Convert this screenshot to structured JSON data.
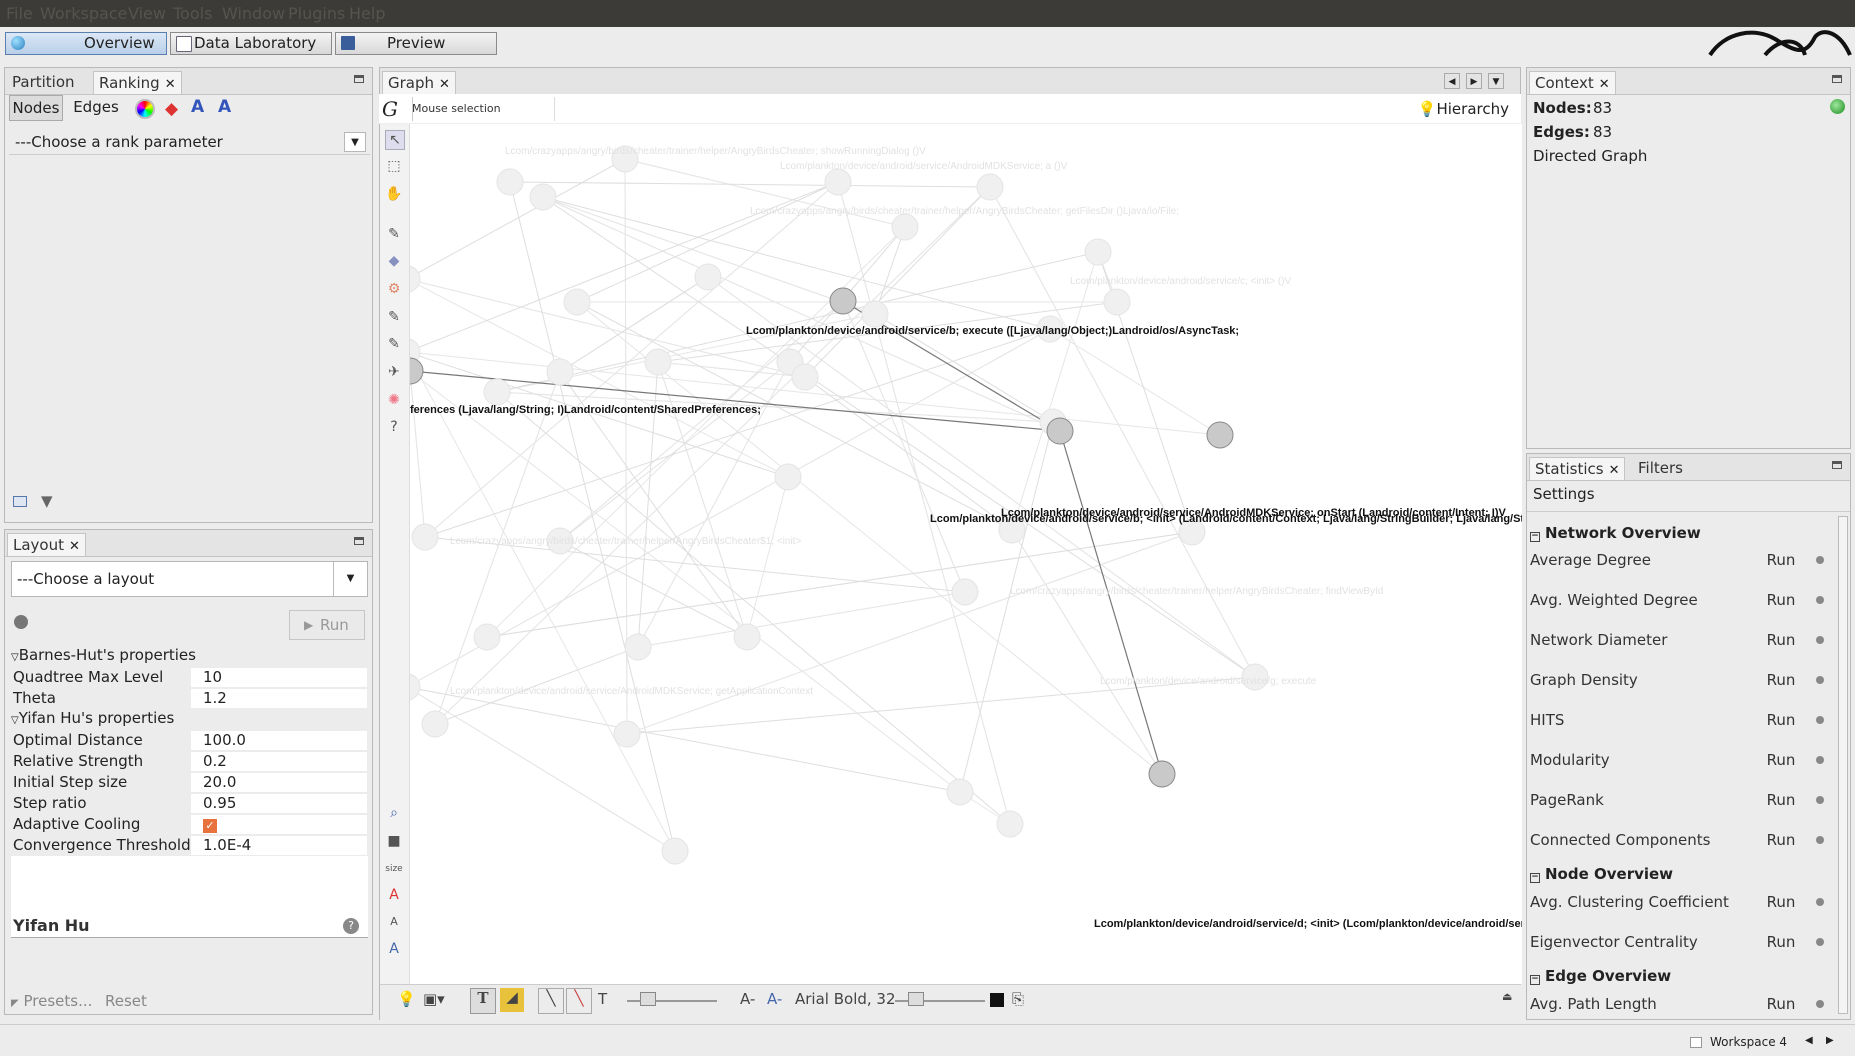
{
  "menu": [
    "File",
    "Workspace",
    "View",
    "Tools",
    "Window",
    "Plugins",
    "Help"
  ],
  "top_tabs": [
    "Overview",
    "Data Laboratory",
    "Preview"
  ],
  "left_panel": {
    "tabs": [
      "Partition",
      "Ranking"
    ],
    "subtabs": [
      "Nodes",
      "Edges"
    ],
    "rank_param": "---Choose a rank parameter"
  },
  "layout_panel": {
    "title": "Layout",
    "choose": "---Choose a layout",
    "run": "Run",
    "bh_section": "Barnes-Hut's properties",
    "yh_section": "Yifan Hu's properties",
    "props": [
      {
        "k": "Quadtree Max Level",
        "v": "10"
      },
      {
        "k": "Theta",
        "v": "1.2"
      },
      {
        "k": "Optimal Distance",
        "v": "100.0"
      },
      {
        "k": "Relative Strength",
        "v": "0.2"
      },
      {
        "k": "Initial Step size",
        "v": "20.0"
      },
      {
        "k": "Step ratio",
        "v": "0.95"
      },
      {
        "k": "Adaptive Cooling",
        "v": ""
      },
      {
        "k": "Convergence Threshold",
        "v": "1.0E-4"
      }
    ],
    "algo_name": "Yifan Hu",
    "presets": "Presets...",
    "reset": "Reset"
  },
  "graph": {
    "tab": "Graph",
    "mode": "Mouse selection",
    "hierarchy": "Hierarchy",
    "font_label": "Arial Bold, 32",
    "node_labels": [
      "Lcom/plankton/device/android/service/b; execute ([Ljava/lang/Object;)Landroid/os/AsyncTask;",
      "ferences (Ljava/lang/String; I)Landroid/content/SharedPreferences;",
      "Lcom/plankton/device/android/service/AndroidMDKService; onStart (Landroid/content/Intent; I)V",
      "Lcom/plankton/device/android/service/b; <init> (Landroid/content/Context; Ljava/lang/StringBuilder; Ljava/lang/Str",
      "Lcom/plankton/device/android/service/d; <init> (Lcom/plankton/device/android/serv"
    ]
  },
  "context": {
    "title": "Context",
    "nodes_label": "Nodes:",
    "nodes": "83",
    "edges_label": "Edges:",
    "edges": "83",
    "type": "Directed Graph"
  },
  "statistics": {
    "tabs": [
      "Statistics",
      "Filters"
    ],
    "settings": "Settings",
    "run": "Run",
    "network_overview": "Network Overview",
    "network_items": [
      "Average Degree",
      "Avg. Weighted Degree",
      "Network Diameter",
      "Graph Density",
      "HITS",
      "Modularity",
      "PageRank",
      "Connected Components"
    ],
    "node_overview": "Node Overview",
    "node_items": [
      "Avg. Clustering Coefficient",
      "Eigenvector Centrality"
    ],
    "edge_overview": "Edge Overview",
    "edge_items": [
      "Avg. Path Length"
    ]
  },
  "status": {
    "workspace": "Workspace 4"
  }
}
